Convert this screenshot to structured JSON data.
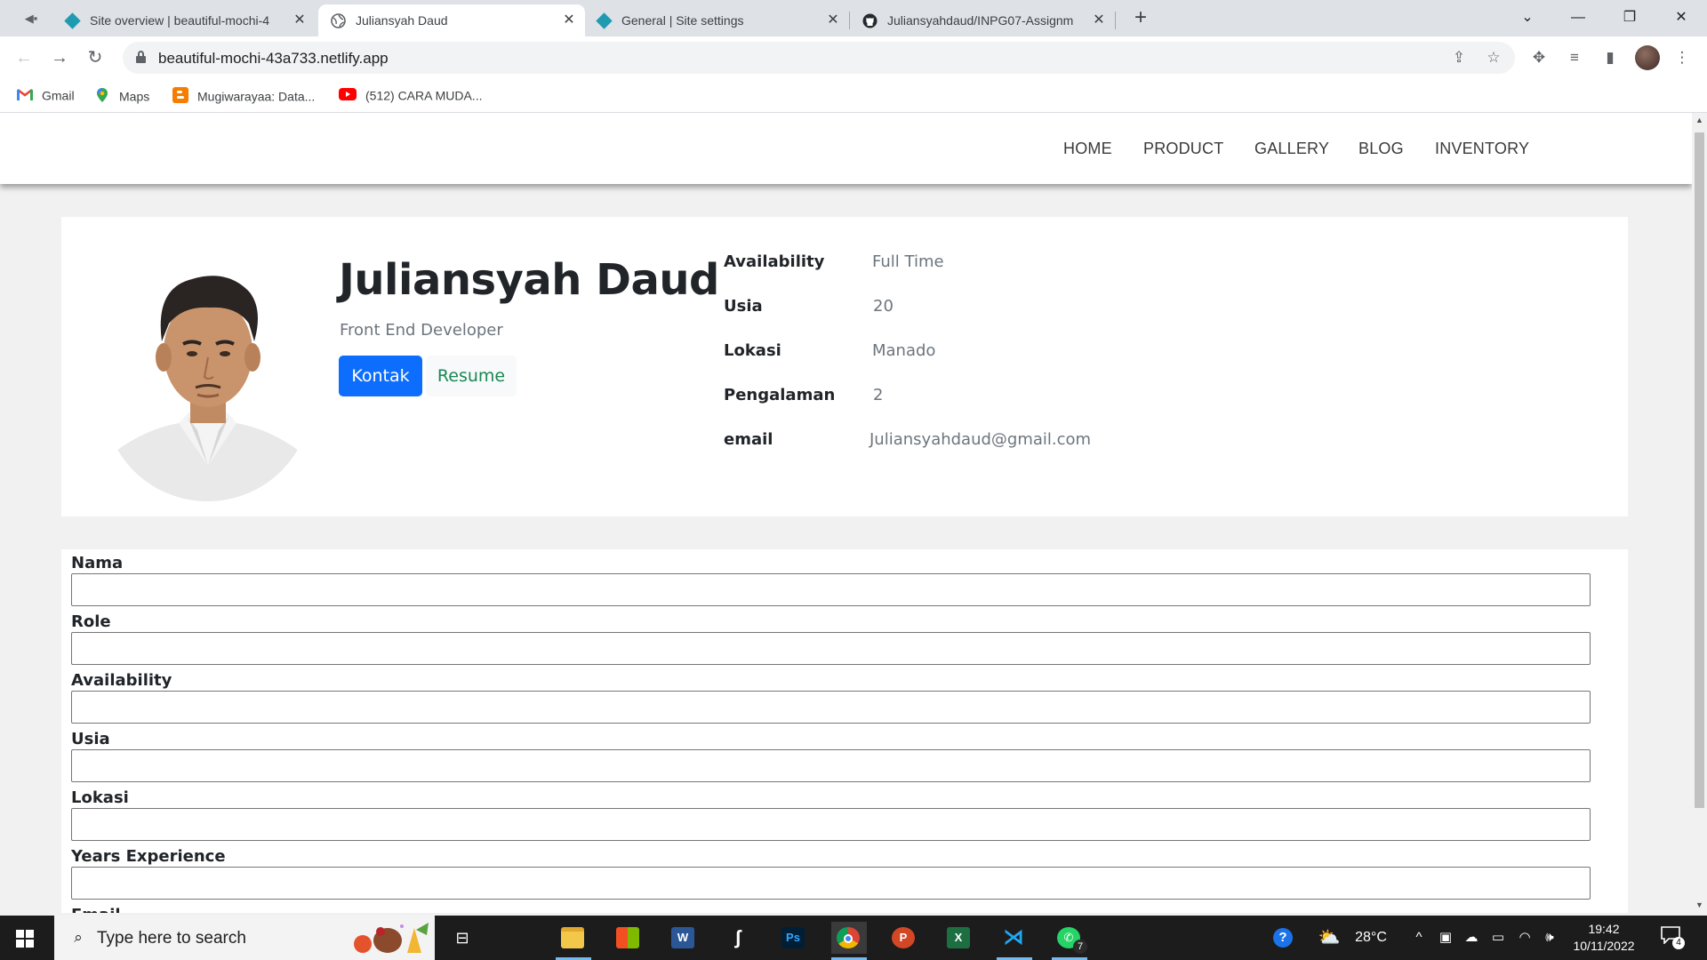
{
  "browser": {
    "tabs": [
      {
        "title": "Site overview | beautiful-mochi-4",
        "favicon": "netlify-diamond-icon",
        "active": false
      },
      {
        "title": "Juliansyah Daud",
        "favicon": "globe-icon",
        "active": true
      },
      {
        "title": "General | Site settings",
        "favicon": "netlify-diamond-icon",
        "active": false
      },
      {
        "title": "Juliansyahdaud/INPG07-Assignm",
        "favicon": "github-icon",
        "active": false
      }
    ],
    "new_tab_glyph": "+",
    "url": "beautiful-mochi-43a733.netlify.app",
    "bookmarks": [
      {
        "label": "Gmail",
        "icon": "gmail-icon"
      },
      {
        "label": "Maps",
        "icon": "maps-icon"
      },
      {
        "label": "Mugiwarayaa: Data...",
        "icon": "blogger-icon"
      },
      {
        "label": "(512) CARA MUDA...",
        "icon": "youtube-icon"
      }
    ]
  },
  "site": {
    "nav": [
      "HOME",
      "PRODUCT",
      "GALLERY",
      "BLOG",
      "INVENTORY"
    ],
    "profile": {
      "name": "Juliansyah Daud",
      "role": "Front End Developer",
      "buttons": {
        "contact": "Kontak",
        "resume": "Resume"
      },
      "details": [
        {
          "label": "Availability",
          "value": "Full Time"
        },
        {
          "label": "Usia",
          "value": "20"
        },
        {
          "label": "Lokasi",
          "value": "Manado"
        },
        {
          "label": "Pengalaman",
          "value": "2"
        },
        {
          "label": "email",
          "value": "Juliansyahdaud@gmail.com"
        }
      ]
    },
    "form": {
      "fields": [
        {
          "label": "Nama",
          "value": ""
        },
        {
          "label": "Role",
          "value": ""
        },
        {
          "label": "Availability",
          "value": ""
        },
        {
          "label": "Usia",
          "value": ""
        },
        {
          "label": "Lokasi",
          "value": ""
        },
        {
          "label": "Years Experience",
          "value": ""
        },
        {
          "label": "Email",
          "value": ""
        }
      ]
    }
  },
  "taskbar": {
    "search_placeholder": "Type here to search",
    "apps": [
      "file-explorer",
      "microsoft-store",
      "word",
      "sublime-text",
      "photoshop",
      "chrome",
      "powerpoint",
      "excel",
      "vscode",
      "whatsapp"
    ],
    "whatsapp_badge": "7",
    "weather": "28°C",
    "time": "19:42",
    "date": "10/11/2022",
    "notification_count": "4"
  },
  "colors": {
    "primary_button": "#0d6efd",
    "resume_text": "#198754",
    "netlify": "#1e9bb1",
    "taskbar": "#1c1c1c"
  }
}
